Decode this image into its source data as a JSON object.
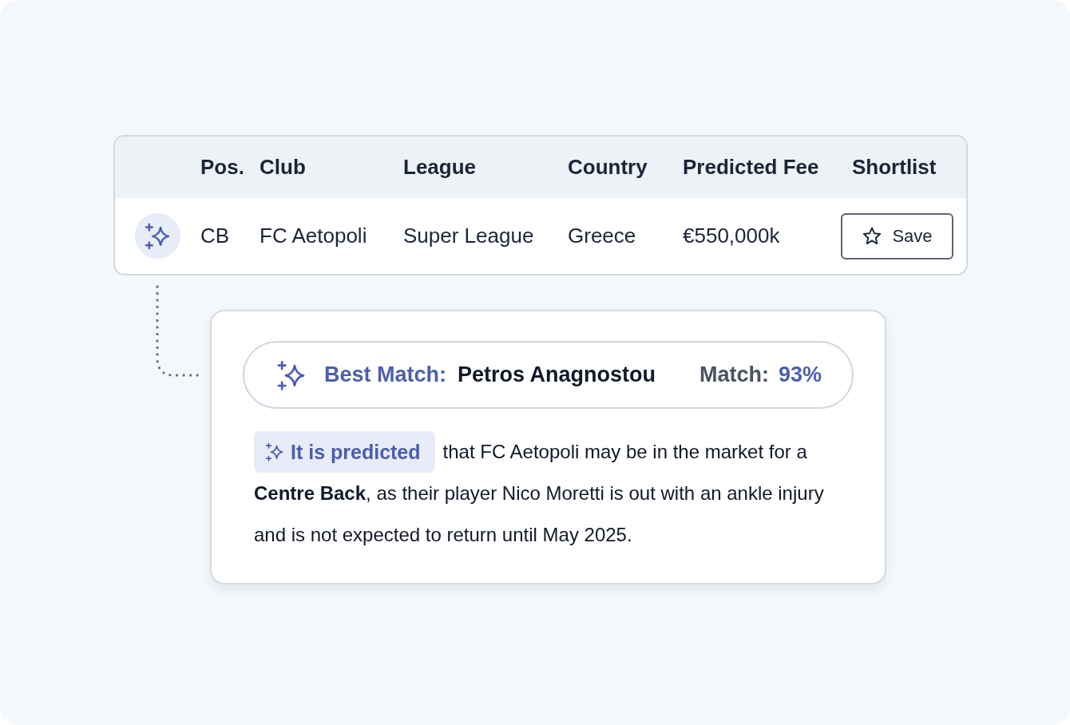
{
  "table": {
    "columns": [
      "Pos.",
      "Club",
      "League",
      "Country",
      "Predicted Fee",
      "Shortlist"
    ],
    "rows": [
      {
        "cells": [
          "CB",
          "FC Aetopoli",
          "Super League",
          "Greece",
          "€550,000k"
        ],
        "shortlist_button": "Save"
      }
    ]
  },
  "prediction_card": {
    "best_match": {
      "label": "Best Match:",
      "player": "Petros Anagnostou",
      "match_label": "Match:",
      "match_value": "93%"
    },
    "tag": "It is predicted",
    "text": "that FC Aetopoli may be in the market for a **Centre Back**, as their player Nico Moretti is out with an ankle injury and is not expected to return until May 2025."
  }
}
